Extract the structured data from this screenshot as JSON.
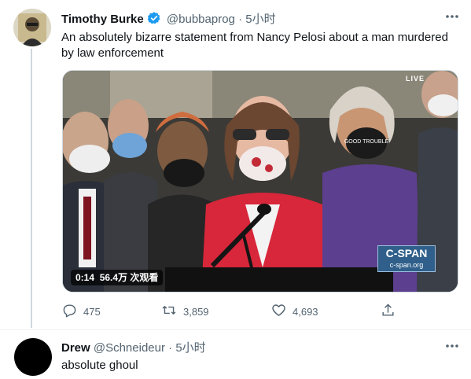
{
  "tweet": {
    "author_name": "Timothy Burke",
    "verified": true,
    "handle": "@bubbaprog",
    "separator": "·",
    "time": "5小时",
    "text": "An absolutely bizarre statement from Nancy Pelosi about a man murdered by law enforcement",
    "video": {
      "live_badge": "LIVE",
      "logo_top": "C-SPAN",
      "logo_bottom": "c-span.org",
      "mask_text": "GOOD TROUBLE",
      "duration": "0:14",
      "views": "56.4万 次观看"
    },
    "actions": {
      "reply_count": "475",
      "retweet_count": "3,859",
      "like_count": "4,693"
    }
  },
  "reply": {
    "author_name": "Drew",
    "handle": "@Schneideur",
    "separator": "·",
    "time": "5小时",
    "text": "absolute ghoul"
  },
  "colors": {
    "secondary_text": "#536471",
    "verified_blue": "#1d9bf0",
    "thread_line": "#cfd9de"
  }
}
